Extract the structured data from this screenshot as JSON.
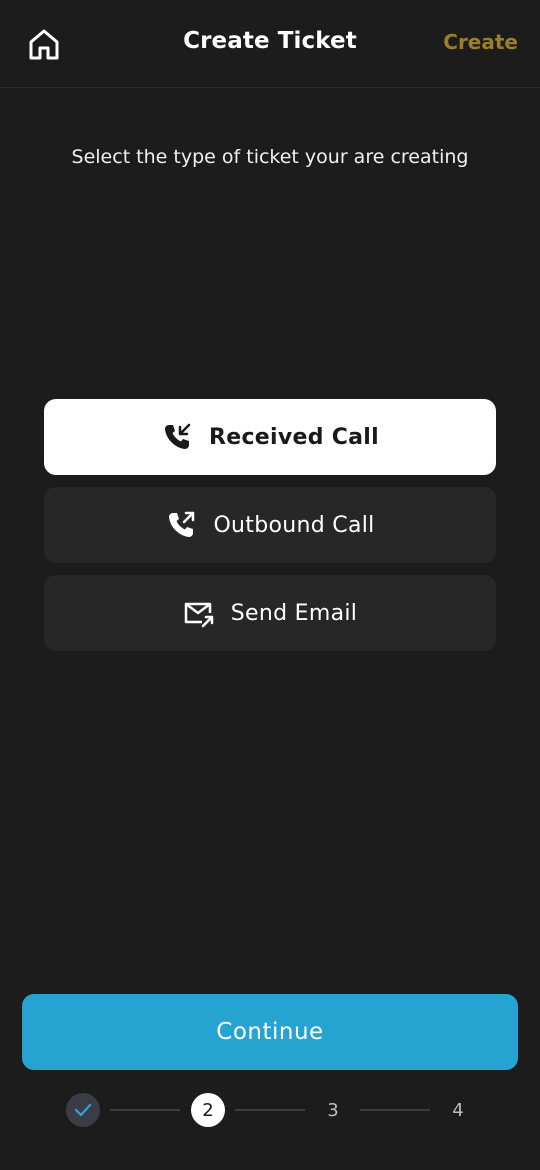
{
  "header": {
    "title": "Create Ticket",
    "create_label": "Create",
    "home_icon": "home-icon"
  },
  "prompt": "Select the type of ticket your are creating",
  "options": [
    {
      "label": "Received Call",
      "icon": "phone-incoming-icon",
      "selected": true
    },
    {
      "label": "Outbound Call",
      "icon": "phone-outgoing-icon",
      "selected": false
    },
    {
      "label": "Send Email",
      "icon": "email-send-icon",
      "selected": false
    }
  ],
  "continue_label": "Continue",
  "stepper": {
    "current_step": 2,
    "steps": [
      {
        "label": "",
        "state": "done",
        "icon": "check-icon"
      },
      {
        "label": "2",
        "state": "current"
      },
      {
        "label": "3",
        "state": "pending"
      },
      {
        "label": "4",
        "state": "pending"
      }
    ]
  },
  "colors": {
    "background": "#1c1c1c",
    "accent": "#25a3d1",
    "create_link": "#9b7e2b",
    "option_bg": "#272727",
    "selected_bg": "#ffffff"
  }
}
